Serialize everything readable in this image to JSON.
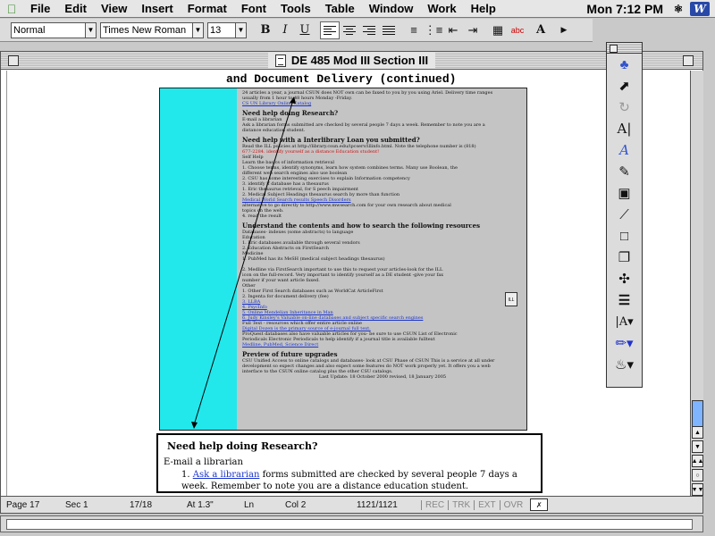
{
  "menubar": {
    "items": [
      "File",
      "Edit",
      "View",
      "Insert",
      "Format",
      "Font",
      "Tools",
      "Table",
      "Window",
      "Work",
      "Help"
    ],
    "clock": "Mon 7:12 PM",
    "app_icon": "W"
  },
  "toolbar": {
    "style": "Normal",
    "font": "Times New Roman",
    "size": "13",
    "bold": "B",
    "italic": "I",
    "underline": "U",
    "color_label": "A"
  },
  "window": {
    "title": "DE 485 Mod III Section III"
  },
  "document": {
    "heading": "and Document Delivery (continued)",
    "screenshot_lines": [
      {
        "t": "24 articles a year, a journal CSUN does NOT own can be faxed to you by you using Ariel. Delivery time ranges",
        "k": "ln"
      },
      {
        "t": "usually from 1 hour to 48 hours Monday -Friday.",
        "k": "ln"
      },
      {
        "t": "CS UN Library Online Catalog",
        "k": "lk"
      },
      {
        "t": "Need help doing Research?",
        "k": "h"
      },
      {
        "t": "E-mail a librarian",
        "k": "ln"
      },
      {
        "t": "Ask a librarian forms submitted are checked by several people 7 days a week. Remember to note you are a",
        "k": "ln"
      },
      {
        "t": "distance education student.",
        "k": "ln"
      },
      {
        "t": "Need help with a Interlibrary Loan you submitted?",
        "k": "h"
      },
      {
        "t": "Read the ILL policies at http://library.csun.edu/ipcserv/illinfo.html. Note the telephone number is (818)",
        "k": "ln"
      },
      {
        "t": "677-2284. identify yourself as a distance Education student!",
        "k": "rd"
      },
      {
        "t": "Self Help",
        "k": "ln"
      },
      {
        "t": "Learn the basics of information retrieval",
        "k": "ln"
      },
      {
        "t": "1. Choose terms, identify synonyms, learn how system combines terms. Many use Boolean, the",
        "k": "ln"
      },
      {
        "t": "   different web search engines also use boolean",
        "k": "ln"
      },
      {
        "t": "2. CSU has some interesting exercises to explain Information competency",
        "k": "ln"
      },
      {
        "t": "3. identify if database has a thesaurus",
        "k": "ln"
      },
      {
        "t": "   1. Eric thesaurus retrieval, for S peech impairment",
        "k": "ln"
      },
      {
        "t": "   2. Medical Subject Headings thesaurus search by more than function",
        "k": "ln"
      },
      {
        "t": "   Medical World Search results Speech Disorders",
        "k": "lk"
      },
      {
        "t": "   alternative to go directly to http://www.mwsearch.com for your own research about medical",
        "k": "ln"
      },
      {
        "t": "   topics on the web.",
        "k": "ln"
      },
      {
        "t": "4. read the result",
        "k": "ln"
      },
      {
        "t": "Understand the contents and how to search the following resources",
        "k": "h"
      },
      {
        "t": "Databases- indexes (some abstracts) to language",
        "k": "ln"
      },
      {
        "t": "   Education",
        "k": "ln"
      },
      {
        "t": "   1. Eric databases available through several vendors",
        "k": "ln"
      },
      {
        "t": "   2. Education Abstracts on FirstSearch",
        "k": "ln"
      },
      {
        "t": "   Medicine",
        "k": "ln"
      },
      {
        "t": "   1. PubMed has its MeSH (medical subject headings thesaurus)",
        "k": "ln"
      },
      {
        "t": "",
        "k": "ln"
      },
      {
        "t": "   2. Medline via FirstSearch important to use this to request your articles-look for the ILL",
        "k": "ln"
      },
      {
        "t": "   icon on the full-record. Very important to identify yourself as a DE student -give your fax",
        "k": "ln"
      },
      {
        "t": "   number if your want article faxed.",
        "k": "ln"
      },
      {
        "t": "   Other",
        "k": "ln"
      },
      {
        "t": "   1. Other First Search databases such as WorldCat ArticleFirst",
        "k": "ln"
      },
      {
        "t": "   2. Ingenta for document delivery (fee)",
        "k": "ln"
      },
      {
        "t": "   3. LLBA",
        "k": "lk"
      },
      {
        "t": "   4. PsycInfo",
        "k": "lk"
      },
      {
        "t": "   5. Online Mendelian Inheritance in Man",
        "k": "lk"
      },
      {
        "t": "   6. Judy Kinsley's Valuable on-line databases and subject specific search engines",
        "k": "lk"
      },
      {
        "t": "Full Text - resources which offer entire article online",
        "k": "ln"
      },
      {
        "t": "   Digital Dozen is the primary source of e-journal full text.",
        "k": "lk"
      },
      {
        "t": "   ProQuest databases also have valuable articles for you- be sure to use CSUN List of Electronic",
        "k": "ln"
      },
      {
        "t": "   Periodicals Electronic Periodicals to help identify if a journal title is available fulltext",
        "k": "ln"
      },
      {
        "t": "   Medline, PubMed, Science Direct",
        "k": "lk"
      },
      {
        "t": "Preview of future upgrades",
        "k": "h"
      },
      {
        "t": "CSU Unified Access to online catalogs and databases- look at CSU Phase of CSUN This is a service at all under",
        "k": "ln"
      },
      {
        "t": "development so expect changes and also expect some features do NOT work properly yet. It offers you a web",
        "k": "ln"
      },
      {
        "t": "interface to the CSUN online catalog plus the other CSU catalogs.",
        "k": "ln"
      },
      {
        "t": "Last Update: 18 October 2000 revised, 18 January 2005",
        "k": "c"
      }
    ],
    "ill_icon": "ILL",
    "zoom": {
      "heading": "Need help doing Research?",
      "subhead": "E-mail a librarian",
      "item_number": "1.",
      "link": "Ask a librarian",
      "item_text": " forms submitted are checked by several people 7 days a week. Remember to note you are a distance education student."
    }
  },
  "status": {
    "page": "Page 17",
    "section": "Sec 1",
    "position": "17/18",
    "at": "At 1.3\"",
    "ln": "Ln",
    "col": "Col 2",
    "words": "1121/1121",
    "modes": [
      "REC",
      "TRK",
      "EXT",
      "OVR"
    ]
  },
  "colors": {
    "link": "#1a33cc",
    "cyan_panel": "#22e8ec",
    "scroll_thumb": "#7fb4ff"
  }
}
